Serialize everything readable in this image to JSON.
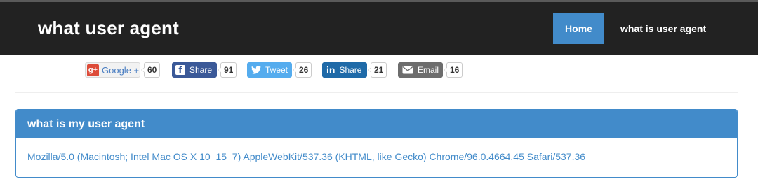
{
  "navbar": {
    "brand": "what user agent",
    "items": [
      {
        "label": "Home"
      },
      {
        "label": "what is user agent"
      }
    ]
  },
  "share": [
    {
      "network": "google-plus",
      "icon": "g+",
      "label": "Google +",
      "count": "60",
      "color": "#dd4b39"
    },
    {
      "network": "facebook",
      "icon": "f",
      "label": "Share",
      "count": "91",
      "color": "#3b5998"
    },
    {
      "network": "twitter",
      "icon": "twitter-bird",
      "label": "Tweet",
      "count": "26",
      "color": "#55acee"
    },
    {
      "network": "linkedin",
      "icon": "in",
      "label": "Share",
      "count": "21",
      "color": "#1f6aa8"
    },
    {
      "network": "email",
      "icon": "envelope",
      "label": "Email",
      "count": "16",
      "color": "#6d6d6d"
    }
  ],
  "panel": {
    "heading": "what is my user agent",
    "user_agent": "Mozilla/5.0 (Macintosh; Intel Mac OS X 10_15_7) AppleWebKit/537.36 (KHTML, like Gecko) Chrome/96.0.4664.45 Safari/537.36"
  },
  "colors": {
    "navbar_bg": "#222222",
    "accent": "#428bca"
  }
}
